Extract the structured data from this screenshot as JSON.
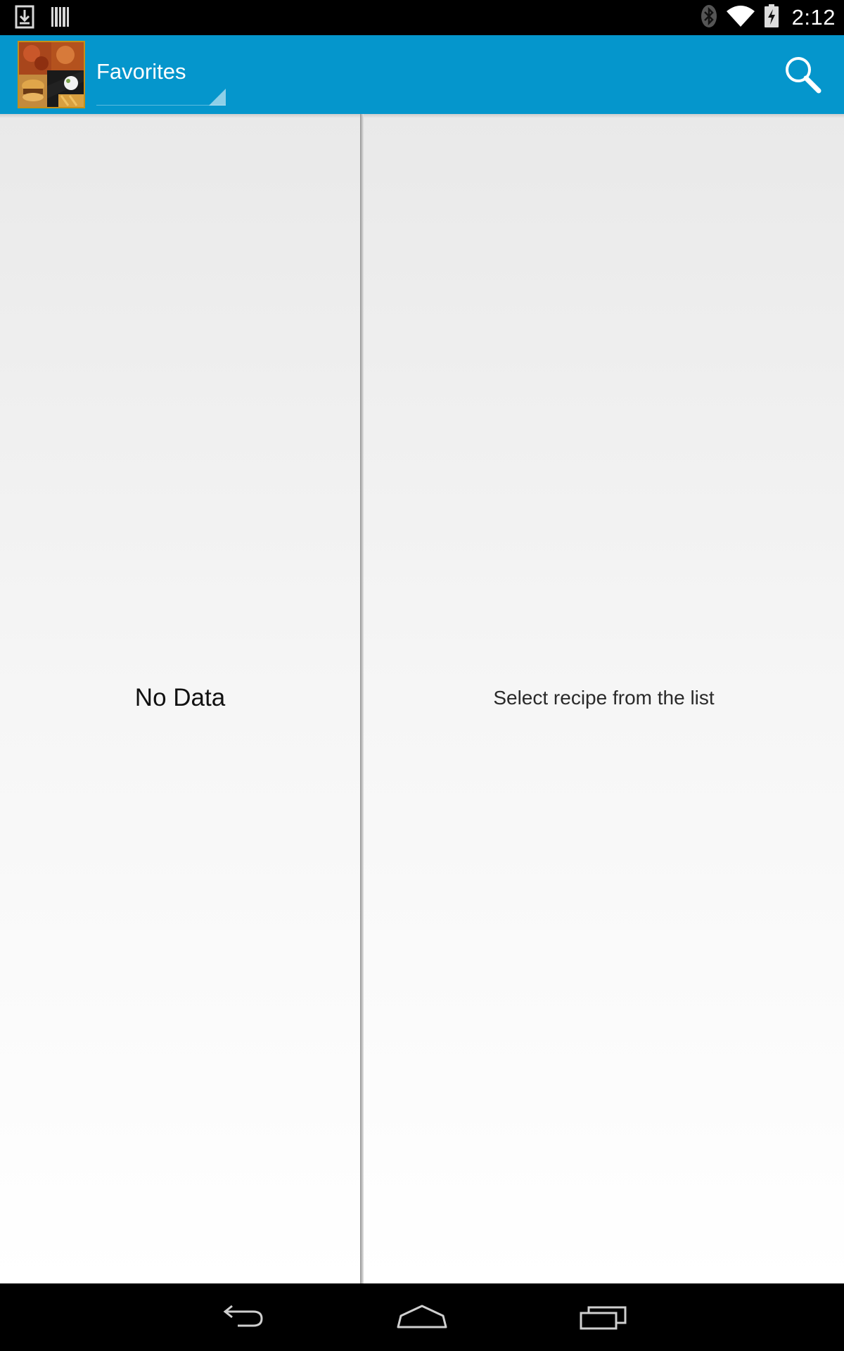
{
  "status_bar": {
    "time": "2:12",
    "left_icons": [
      "download-icon",
      "barcode-icon"
    ],
    "right_icons": [
      "bluetooth-icon",
      "wifi-icon",
      "battery-charging-icon"
    ]
  },
  "action_bar": {
    "background_color": "#0596CC",
    "logo_icon": "food-collage-logo",
    "nav_title": "Favorites",
    "search_icon": "search-icon"
  },
  "list_pane": {
    "empty_text": "No Data"
  },
  "detail_pane": {
    "hint_text": "Select recipe from the list"
  },
  "nav_bar": {
    "buttons": [
      "back-icon",
      "home-icon",
      "recent-apps-icon"
    ]
  }
}
